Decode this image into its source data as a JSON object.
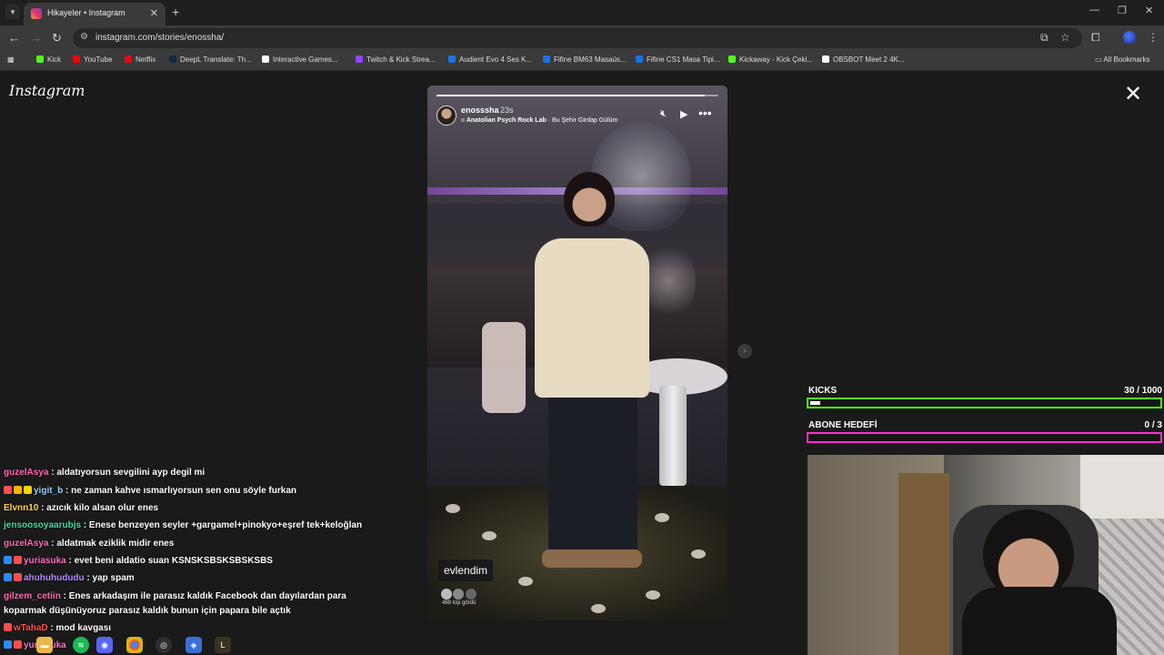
{
  "browser": {
    "tab_title": "Hikayeler • Instagram",
    "url": "instagram.com/stories/enossha/",
    "bookmarks": [
      {
        "label": "Kick",
        "color": "#53fc18"
      },
      {
        "label": "YouTube",
        "color": "#ff0000"
      },
      {
        "label": "Netflix",
        "color": "#e50914"
      },
      {
        "label": "DeepL Translate: Th...",
        "color": "#0f2b46"
      },
      {
        "label": "Interactive Games...",
        "color": "#ffffff"
      },
      {
        "label": "Twitch & Kick Strea...",
        "color": "#9146ff"
      },
      {
        "label": "Audient Evo 4 Ses K...",
        "color": "#1a73e8"
      },
      {
        "label": "Fifine BM63 Masaüs...",
        "color": "#1a73e8"
      },
      {
        "label": "Fifine CS1 Masa Tipi...",
        "color": "#1a73e8"
      },
      {
        "label": "Kickaway - Kick Çeki...",
        "color": "#53fc18"
      },
      {
        "label": "OBSBOT Meet 2 4K...",
        "color": "#ffffff"
      }
    ],
    "all_bookmarks": "All Bookmarks"
  },
  "instagram": {
    "logo": "Instagram",
    "story": {
      "username": "enosssha",
      "time": "23s",
      "music_artist": "Anatolian Psych Rock Lab",
      "music_song": " · Bu Şehir Girdap Gülüm",
      "sticker": "evlendim",
      "viewers": "489 kişi gördü",
      "progress": 0.95
    }
  },
  "chat": [
    {
      "user": "guzelAsya",
      "color": "#ff69b4",
      "message": " : aldatıyorsun sevgilini ayp degil mi",
      "badges": []
    },
    {
      "user": "yigit_b",
      "color": "#9ad0ff",
      "message": " : ne zaman kahve ısmarlıyorsun sen onu söyle furkan",
      "badges": [
        "#ff4d4d",
        "#ffb000",
        "#ffd000"
      ]
    },
    {
      "user": "Elvnn10",
      "color": "#ffd24d",
      "message": " : azıcık kilo alsan olur enes",
      "badges": []
    },
    {
      "user": "jensoosoyaarubjs",
      "color": "#4dd6a0",
      "message": " : Enese benzeyen seyler +gargamel+pinokyo+eşref tek+keloğlan",
      "badges": []
    },
    {
      "user": "guzelAsya",
      "color": "#ff69b4",
      "message": " : aldatmak eziklik midir enes",
      "badges": []
    },
    {
      "user": "yuriasuka",
      "color": "#ff6ec7",
      "message": " : evet beni aldatio suan KSNSKSBSKSBSKSBS",
      "badges": [
        "#2b8cff",
        "#ff4d4d"
      ]
    },
    {
      "user": "ahuhuhududu",
      "color": "#b28cff",
      "message": " : yap spam",
      "badges": [
        "#2b8cff",
        "#ff4d4d"
      ]
    },
    {
      "user": "gilzem_cetiin",
      "color": "#ff69b4",
      "message": " : Enes arkadaşım ile parasız kaldık Facebook dan dayılardan para",
      "badges": []
    },
    {
      "user": "",
      "color": "#ffffff",
      "message": "koparmak düşünüyoruz parasız kaldık bunun için papara bile açtık",
      "badges": []
    },
    {
      "user": "wTahaD",
      "color": "#ff4d4d",
      "message": " : mod kavgası",
      "badges": [
        "#ff4d4d"
      ]
    },
    {
      "user": "yuriasuka",
      "color": "#ff6ec7",
      "message": "",
      "badges": [
        "#2b8cff",
        "#ff4d4d"
      ]
    }
  ],
  "goals": {
    "kicks": {
      "label": "KICKS",
      "current": "30",
      "total": " / 1000",
      "progress": 0.03,
      "color": "#53fc18"
    },
    "abone": {
      "label": "ABONE HEDEFİ",
      "current": "0",
      "total": " / 3",
      "progress": 0.0,
      "color": "#ff2ed1"
    }
  },
  "colors": {
    "kick_green": "#53fc18",
    "goal_pink": "#ff2ed1"
  }
}
